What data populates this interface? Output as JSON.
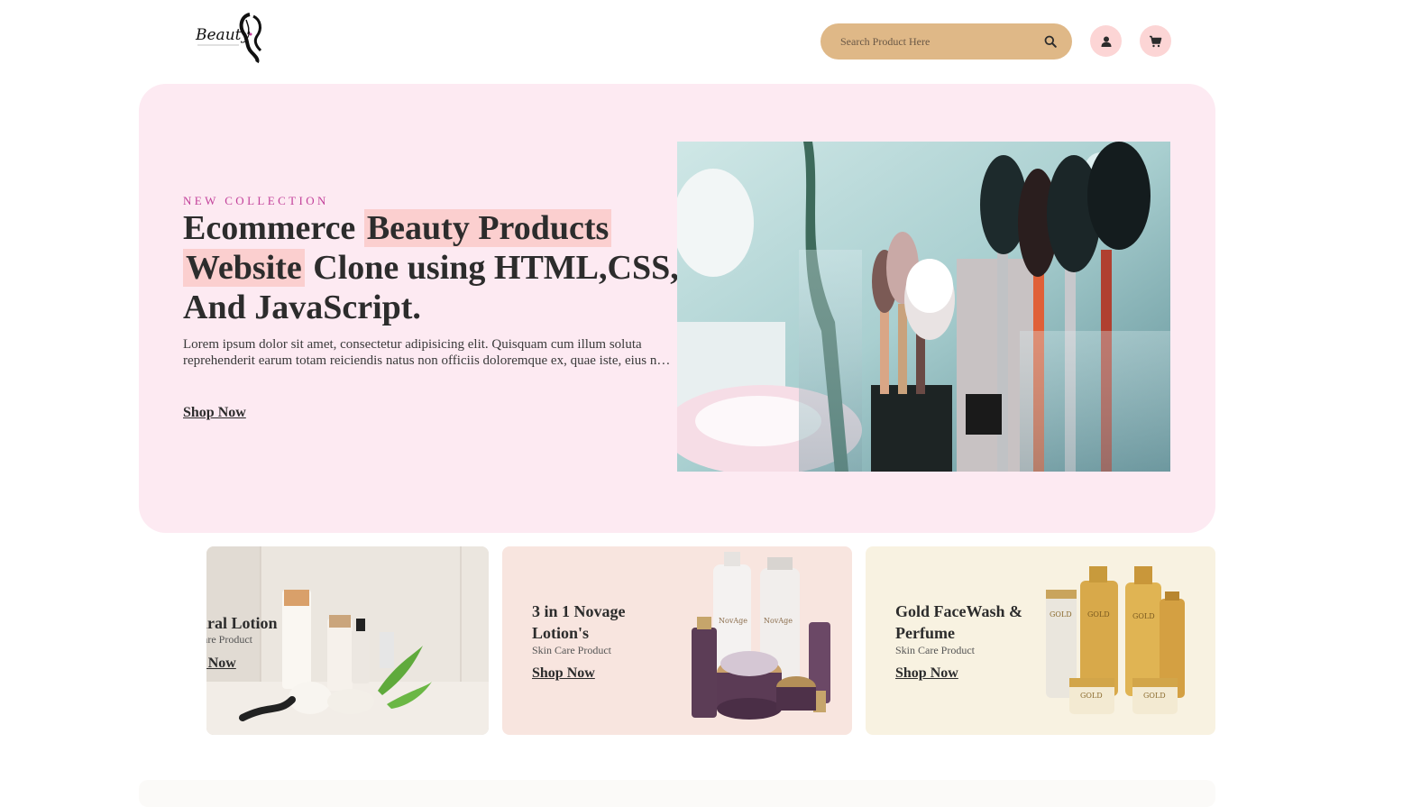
{
  "header": {
    "logo_text": "Beauty",
    "search_placeholder": "Search Product Here",
    "search_icon": "search-icon",
    "user_icon": "user-icon",
    "cart_icon": "cart-icon"
  },
  "hero": {
    "eyebrow": "NEW COLLECTION",
    "headline_part1": "Ecommerce ",
    "headline_highlight1": "Beauty Products",
    "headline_highlight2": "Website",
    "headline_part2": " Clone using HTML,CSS, And JavaScript.",
    "description_line1": "Lorem ipsum dolor sit amet, consectetur adipisicing elit. Quisquam cum illum soluta",
    "description_line2": "reprehenderit earum totam reiciendis natus non officiis doloremque ex, quae iste, eius nobis",
    "cta": "Shop Now"
  },
  "cards": [
    {
      "title": "Natural Lotion",
      "subtitle": "Skin Care Product",
      "cta": "Shop Now"
    },
    {
      "title": "3 in 1 Novage Lotion's",
      "subtitle": "Skin Care Product",
      "cta": "Shop Now",
      "brand_label": "NovAge"
    },
    {
      "title": "Gold FaceWash & Perfume",
      "subtitle": "Skin Care Product",
      "cta": "Shop Now",
      "brand_label": "GOLD"
    }
  ],
  "colors": {
    "hero_bg": "#fdeaf2",
    "accent_pink": "#c2409a",
    "highlight": "#fbcfcf",
    "search_bg": "#dfb887",
    "icon_btn_bg": "#fcd5d5"
  }
}
